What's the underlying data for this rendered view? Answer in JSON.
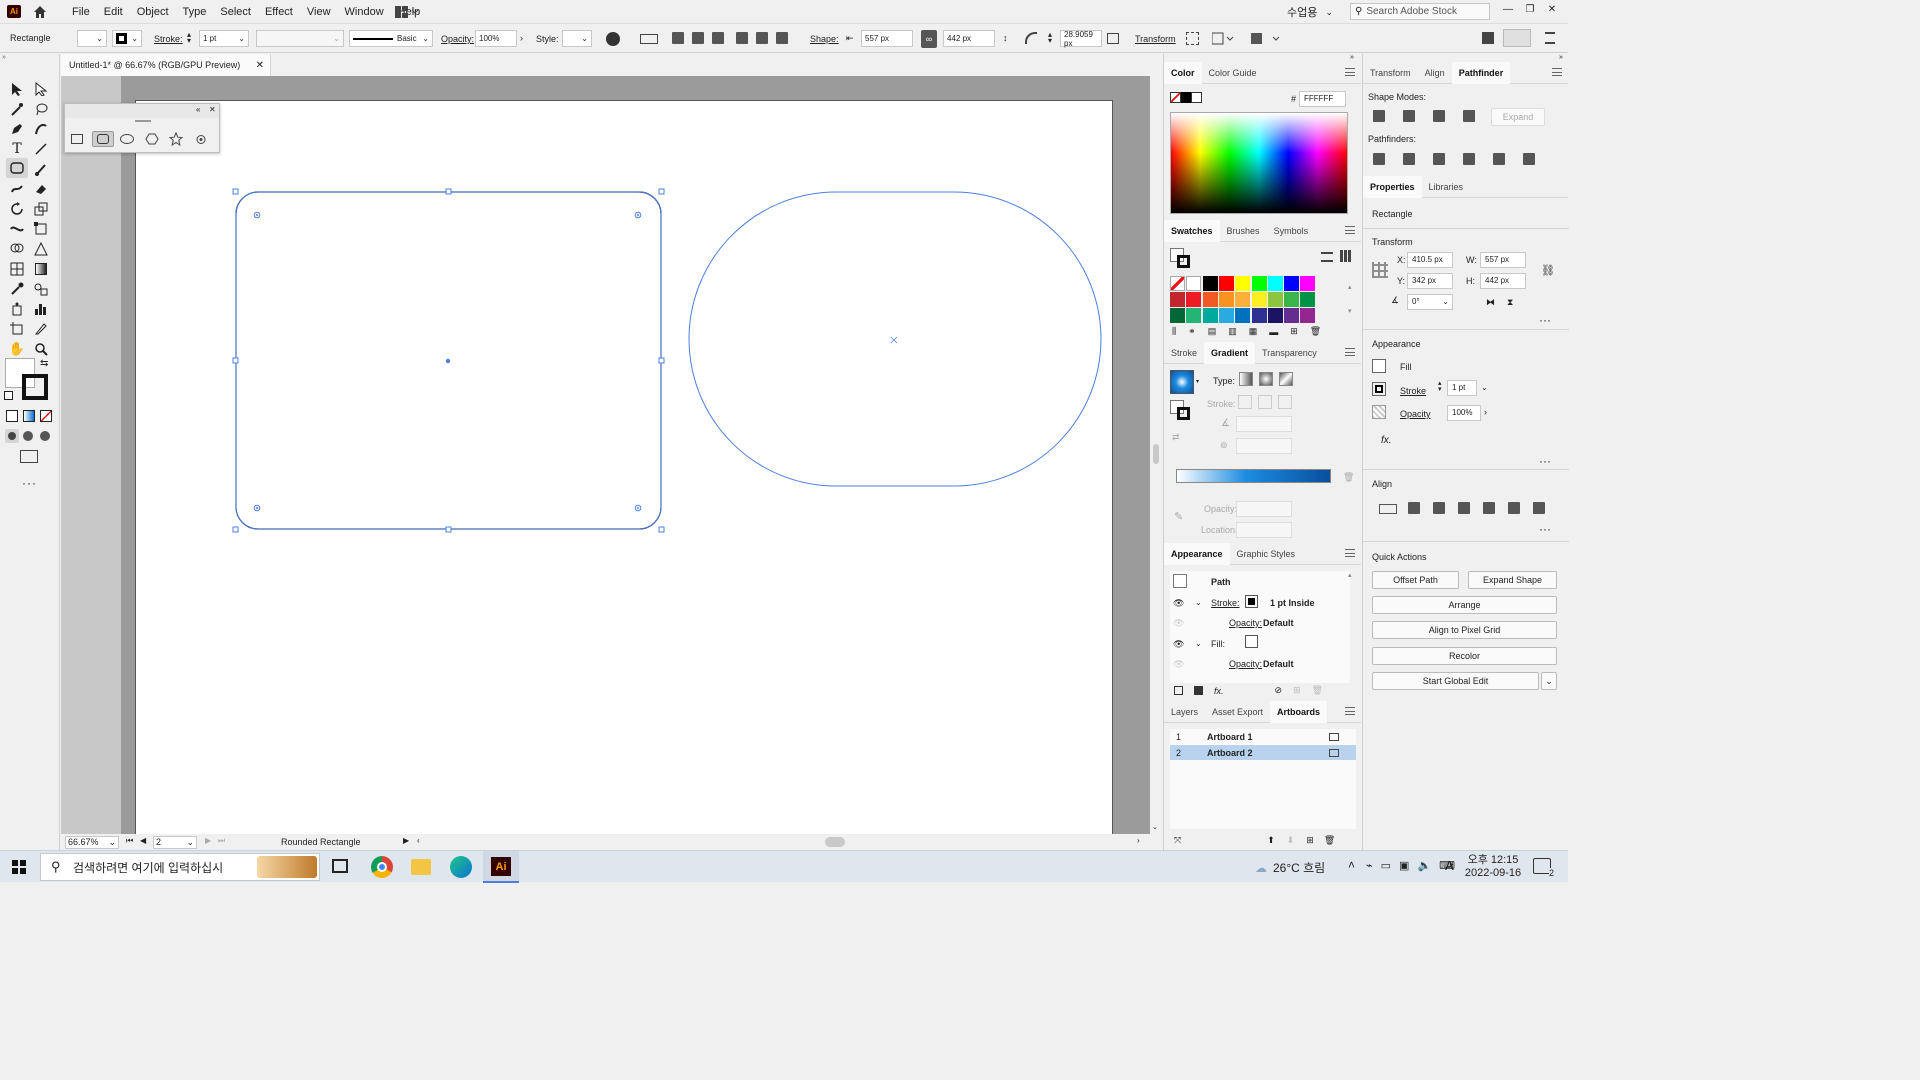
{
  "app": {
    "logo": "Ai",
    "menus": [
      "File",
      "Edit",
      "Object",
      "Type",
      "Select",
      "Effect",
      "View",
      "Window",
      "Help"
    ],
    "workspace": "수업용",
    "search_placeholder": "Search Adobe Stock"
  },
  "control_bar": {
    "object_type": "Rectangle",
    "stroke_label": "Stroke:",
    "stroke_value": "1 pt",
    "brush_label": "Basic",
    "opacity_label": "Opacity:",
    "opacity_value": "100%",
    "style_label": "Style:",
    "shape_label": "Shape:",
    "width_value": "557 px",
    "height_value": "442 px",
    "corner_value": "28.9059 px",
    "transform_label": "Transform"
  },
  "document": {
    "tab_title": "Untitled-1* @ 66.67% (RGB/GPU Preview)",
    "zoom": "66.67%",
    "artboard_number": "2",
    "current_tool": "Rounded Rectangle"
  },
  "color_panel": {
    "tabs": [
      "Color",
      "Color Guide"
    ],
    "hex_label": "#",
    "hex_value": "FFFFFF"
  },
  "swatches_panel": {
    "tabs": [
      "Swatches",
      "Brushes",
      "Symbols"
    ],
    "rows": [
      [
        "none",
        "#ffffff",
        "#000000",
        "#ff0000",
        "#ffff00",
        "#00ff00",
        "#00ffff",
        "#0000ff",
        "#ff00ff"
      ],
      [
        "#c1272d",
        "#ed1c24",
        "#f15a24",
        "#f7931e",
        "#fbb03b",
        "#fcee21",
        "#8cc63f",
        "#39b54a",
        "#009245"
      ],
      [
        "#006837",
        "#22b573",
        "#00a99d",
        "#29abe2",
        "#0071bc",
        "#2e3192",
        "#1b1464",
        "#662d91",
        "#93278f"
      ]
    ]
  },
  "gradient_panel": {
    "tabs": [
      "Stroke",
      "Gradient",
      "Transparency"
    ],
    "type_label": "Type:",
    "stroke_label": "Stroke:",
    "opacity_label": "Opacity:",
    "location_label": "Location:"
  },
  "appearance_panel": {
    "tabs": [
      "Appearance",
      "Graphic Styles"
    ],
    "title": "Path",
    "stroke_label": "Stroke:",
    "stroke_value": "1 pt  Inside",
    "opacity_label": "Opacity:",
    "opacity_value": "Default",
    "fill_label": "Fill:",
    "opacity2_value": "Default"
  },
  "artboards_panel": {
    "tabs": [
      "Layers",
      "Asset Export",
      "Artboards"
    ],
    "items": [
      {
        "num": "1",
        "name": "Artboard 1"
      },
      {
        "num": "2",
        "name": "Artboard 2"
      }
    ]
  },
  "right_panel": {
    "tabs": [
      "Transform",
      "Align",
      "Pathfinder"
    ],
    "shape_modes_label": "Shape Modes:",
    "expand_label": "Expand",
    "pathfinders_label": "Pathfinders:",
    "prop_tabs": [
      "Properties",
      "Libraries"
    ],
    "object_type": "Rectangle",
    "transform_label": "Transform",
    "x_label": "X:",
    "x_value": "410.5 px",
    "y_label": "Y:",
    "y_value": "342 px",
    "w_label": "W:",
    "w_value": "557 px",
    "h_label": "H:",
    "h_value": "442 px",
    "angle_value": "0°",
    "appearance_label": "Appearance",
    "fill_label": "Fill",
    "stroke_label": "Stroke",
    "stroke_value": "1 pt",
    "opacity_label": "Opacity",
    "opacity_value": "100%",
    "fx_label": "fx.",
    "align_label": "Align",
    "quick_actions_label": "Quick Actions",
    "offset_path": "Offset Path",
    "expand_shape": "Expand Shape",
    "arrange": "Arrange",
    "align_pixel_grid": "Align to Pixel Grid",
    "recolor": "Recolor",
    "global_edit": "Start Global Edit"
  },
  "taskbar": {
    "search_text": "검색하려면 여기에 입력하십시",
    "weather": "26°C 흐림",
    "ime": "A",
    "time": "오후 12:15",
    "date": "2022-09-16",
    "notifications": "2"
  }
}
